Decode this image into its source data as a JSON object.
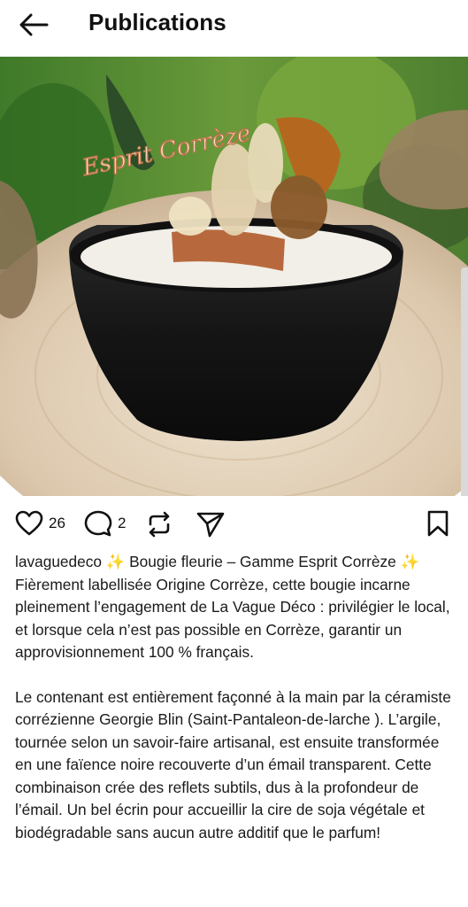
{
  "header": {
    "title": "Publications",
    "back_icon": "arrow-left-icon"
  },
  "post": {
    "media": {
      "alt_icon": "volume-icon",
      "sign_text": "Esprit Corrèze"
    },
    "actions": {
      "likes": "26",
      "comments": "2"
    },
    "caption": {
      "username": "lavaguedeco",
      "line1": " ✨ Bougie fleurie – Gamme Esprit Corrèze ✨",
      "paragraph1": "Fièrement labellisée Origine Corrèze, cette bougie incarne pleinement l’engagement de La Vague Déco : privilégier le local, et lorsque cela n’est pas possible en Corrèze, garantir un approvisionnement 100 % français.",
      "paragraph2": "Le contenant est entièrement façonné à la main par la céramiste corrézienne Georgie Blin (Saint-Pantaleon-de-larche ). L’argile, tournée selon un savoir-faire artisanal, est ensuite transformée en une faïence noire recouverte d’un émail transparent. Cette combinaison crée des reflets subtils, dus à la profondeur de l’émail. Un bel écrin pour accueillir la cire de soja végétale et biodégradable sans aucun autre additif que le parfum!"
    }
  }
}
